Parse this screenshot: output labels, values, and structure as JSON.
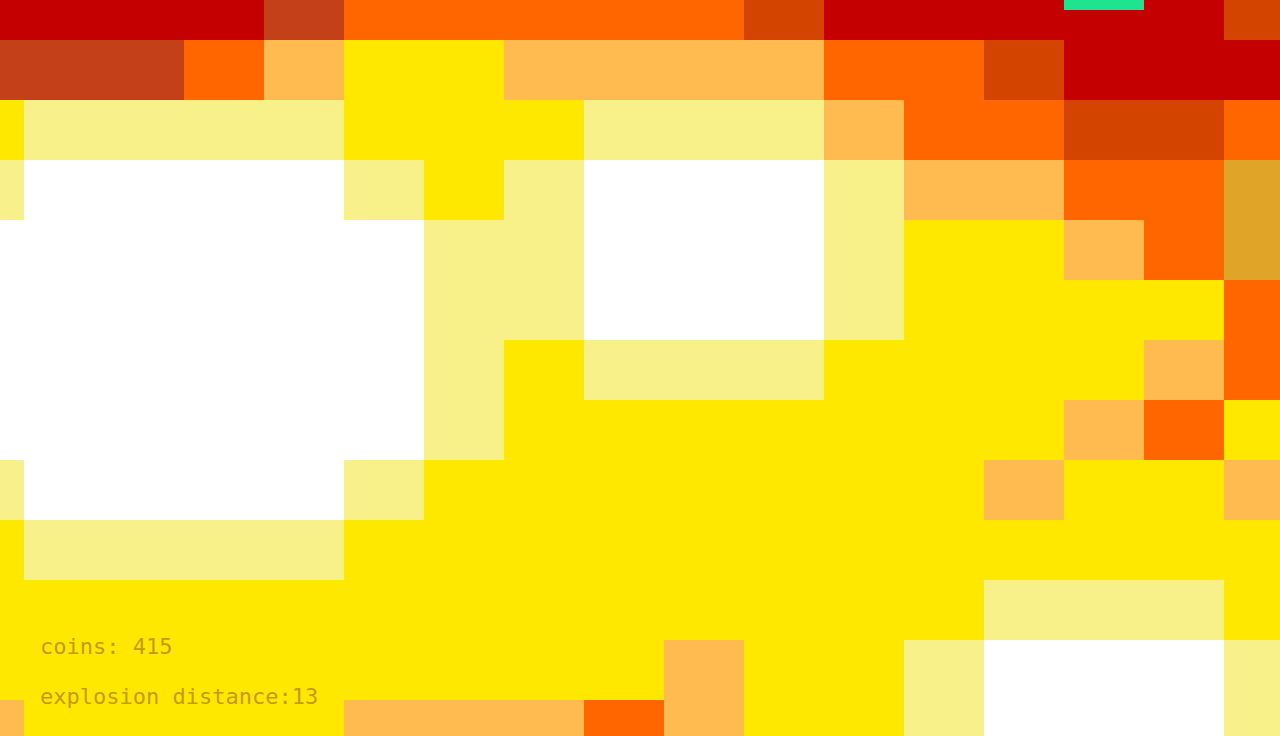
{
  "map": {
    "legend": {
      "W": "#ffffff",
      "P": "#f8f088",
      "Y": "#ffe800",
      "L": "#ffba50",
      "O": "#ff6600",
      "D": "#d24400",
      "R": "#c44018",
      "C": "#c40000",
      "G": "#e0a428"
    },
    "rows": [
      "CCCCROOOOODCCCCCD",
      "RRROLYYLLLLOODCCC",
      "YPPPPYYYPPPLOODDO",
      "PWWWWPYPWWWPLLOOG",
      "WWWWWWPPWWWPYYLOG",
      "WWWWWWPPWWWPYYYYO",
      "WWWWWWPYPPPYYYYLO",
      "WWWWWWPYYYYYYYLOY",
      "PWWWWPYYYYYYYLYYL",
      "YPPPPYYYYYYYYYYYY",
      "YYYYYYYYYYYYYPPPY",
      "YYYYYYYYYLYYPWWWP",
      "LYYYYLLLOLYYPWWWP"
    ]
  },
  "marker": {
    "visible": true
  },
  "hud": {
    "lines": [
      "coins: 415",
      "explosion distance:13"
    ]
  }
}
